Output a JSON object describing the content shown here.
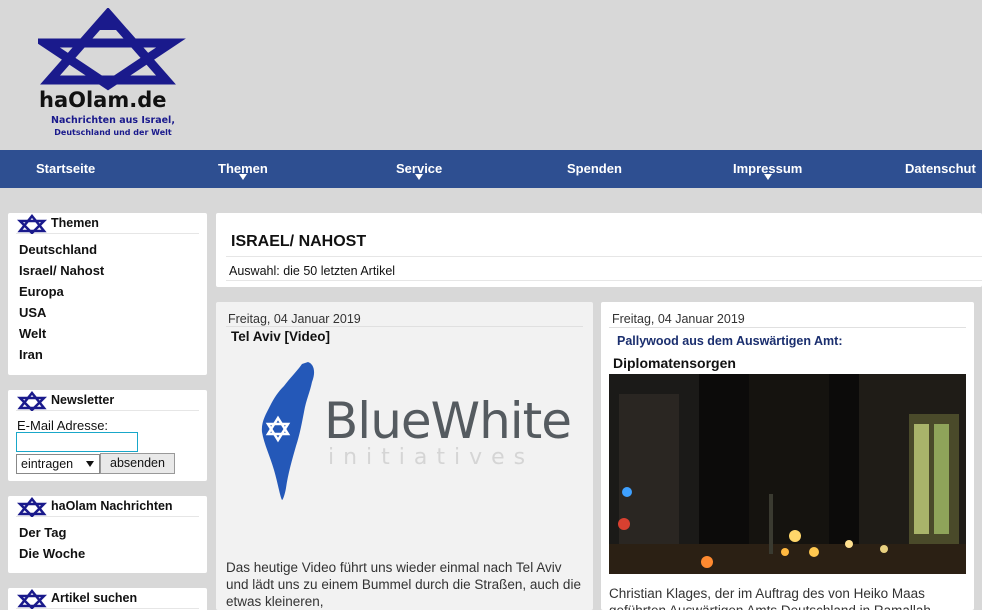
{
  "site": {
    "name": "haOlam.de",
    "tagline_line1": "Nachrichten aus Israel,",
    "tagline_line2": "Deutschland und der Welt"
  },
  "nav": {
    "items": [
      {
        "label": "Startseite",
        "has_dropdown": false
      },
      {
        "label": "Themen",
        "has_dropdown": true
      },
      {
        "label": "Service",
        "has_dropdown": true
      },
      {
        "label": "Spenden",
        "has_dropdown": false
      },
      {
        "label": "Impressum",
        "has_dropdown": true
      },
      {
        "label": "Datenschut",
        "has_dropdown": false
      }
    ]
  },
  "sidebar": {
    "themen": {
      "title": "Themen",
      "links": [
        "Deutschland",
        "Israel/ Nahost",
        "Europa",
        "USA",
        "Welt",
        "Iran"
      ]
    },
    "newsletter": {
      "title": "Newsletter",
      "email_label": "E-Mail Adresse:",
      "email_value": "",
      "select_value": "eintragen",
      "submit_label": "absenden"
    },
    "nachrichten": {
      "title": "haOlam Nachrichten",
      "links": [
        "Der Tag",
        "Die Woche"
      ]
    },
    "suche": {
      "title": "Artikel suchen"
    }
  },
  "main": {
    "section_title": "ISRAEL/ NAHOST",
    "selection_text": "Auswahl: die 50 letzten Artikel",
    "articles": [
      {
        "date": "Freitag, 04 Januar 2019",
        "title": "Tel Aviv [Video]",
        "image_text_1": "BlueWhite",
        "image_text_2": "initiatives",
        "excerpt": "Das heutige Video führt uns wieder einmal nach Tel Aviv und lädt uns zu einem Bummel durch die Straßen, auch die etwas kleineren,"
      },
      {
        "date": "Freitag, 04 Januar 2019",
        "kicker": "Pallywood aus dem Auswärtigen Amt:",
        "title": "Diplomatensorgen",
        "excerpt_line1": "Christian Klages, der im Auftrag des von Heiko Maas",
        "excerpt_line2": "geführten Auswärtigen Amts Deutschland in Ramallah"
      }
    ]
  },
  "colors": {
    "nav_bg": "#2e4f91",
    "logo_blue": "#1a1a8c",
    "page_bg": "#d8d8d8"
  }
}
